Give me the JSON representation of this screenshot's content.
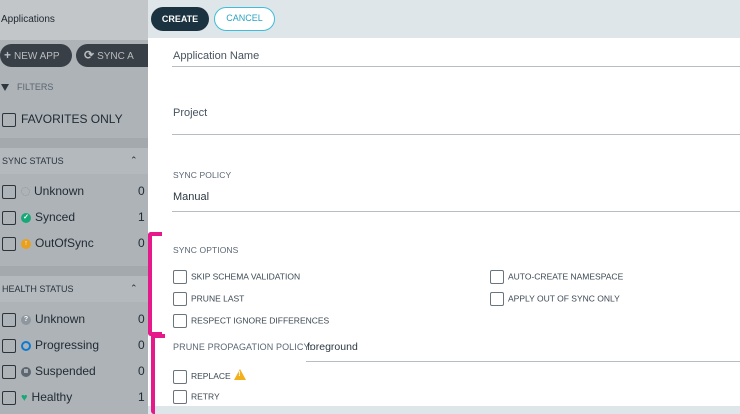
{
  "sidebar": {
    "title": "Applications",
    "new_app": "NEW APP",
    "sync_apps": "SYNC A",
    "filters": "FILTERS",
    "favorites": "FAVORITES ONLY",
    "sync_status": {
      "heading": "SYNC STATUS",
      "items": [
        {
          "label": "Unknown",
          "count": "0"
        },
        {
          "label": "Synced",
          "count": "1"
        },
        {
          "label": "OutOfSync",
          "count": "0"
        }
      ]
    },
    "health_status": {
      "heading": "HEALTH STATUS",
      "items": [
        {
          "label": "Unknown",
          "count": "0"
        },
        {
          "label": "Progressing",
          "count": "0"
        },
        {
          "label": "Suspended",
          "count": "0"
        },
        {
          "label": "Healthy",
          "count": "1"
        }
      ]
    }
  },
  "toolbar": {
    "create": "CREATE",
    "cancel": "CANCEL"
  },
  "form": {
    "application_name": {
      "label": "Application Name"
    },
    "project": {
      "label": "Project"
    },
    "sync_policy": {
      "label": "SYNC POLICY",
      "value": "Manual"
    },
    "sync_options": {
      "heading": "SYNC OPTIONS",
      "skip_schema_validation": "SKIP SCHEMA VALIDATION",
      "auto_create_namespace": "AUTO-CREATE NAMESPACE",
      "prune_last": "PRUNE LAST",
      "apply_out_of_sync_only": "APPLY OUT OF SYNC ONLY",
      "respect_ignore_differences": "RESPECT IGNORE DIFFERENCES",
      "prune_propagation_policy": {
        "label": "PRUNE PROPAGATION POLICY:",
        "value": "foreground"
      },
      "replace": "REPLACE",
      "retry": "RETRY"
    }
  },
  "colors": {
    "accent": "#3dbdd7",
    "primary": "#1b3240",
    "annotation": "#e6198a",
    "warning": "#f2b01e"
  }
}
